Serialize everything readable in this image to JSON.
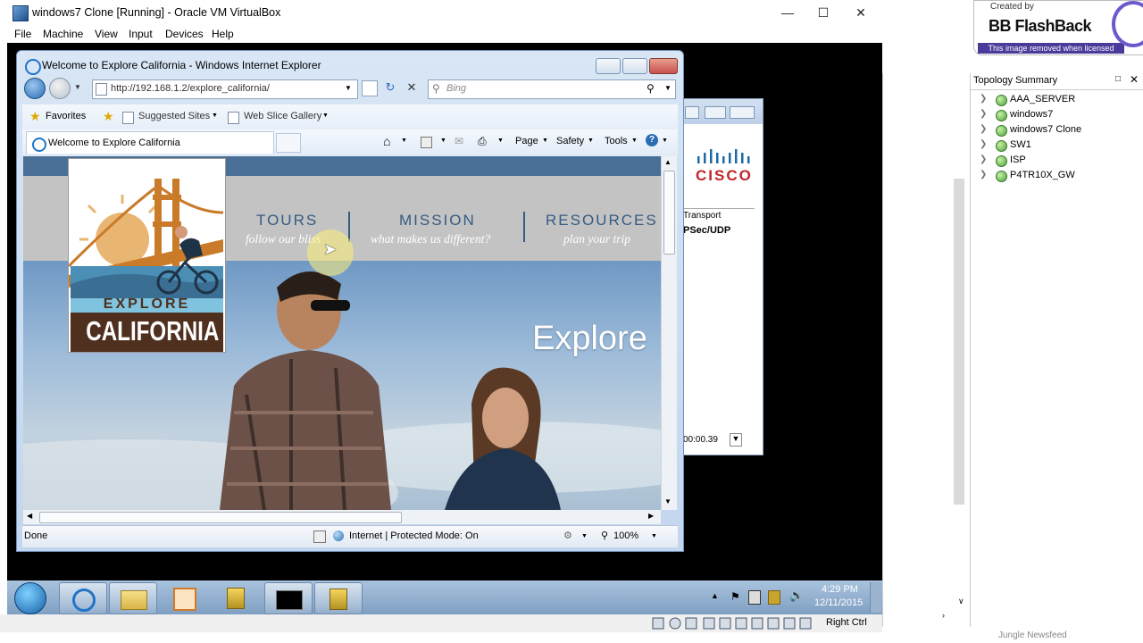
{
  "vbox": {
    "title": "windows7 Clone [Running] - Oracle VM VirtualBox",
    "menu": [
      "File",
      "Machine",
      "View",
      "Input",
      "Devices",
      "Help"
    ],
    "status_hotkey": "Right Ctrl"
  },
  "watermark": {
    "created_by": "Created by",
    "brand": "BB FlashBack",
    "removed_note": "This image removed when licensed"
  },
  "topology": {
    "title": "Topology Summary",
    "items": [
      "AAA_SERVER",
      "windows7",
      "windows7 Clone",
      "SW1",
      "ISP",
      "P4TR10X_GW"
    ]
  },
  "bottom_hint": "Jungle Newsfeed",
  "cisco_window": {
    "logo_text": "CISCO",
    "col_header": "Transport",
    "cell": "PSec/UDP",
    "timer": "00:00.39"
  },
  "ie": {
    "window_title": "Welcome to Explore California - Windows Internet Explorer",
    "url": "http://192.168.1.2/explore_california/",
    "search_placeholder": "Bing",
    "favorites_label": "Favorites",
    "suggested_sites": "Suggested Sites",
    "web_slice_gallery": "Web Slice Gallery",
    "tab_title": "Welcome to Explore California",
    "cmd": {
      "page": "Page",
      "safety": "Safety",
      "tools": "Tools"
    },
    "status_done": "Done",
    "status_zone": "Internet | Protected Mode: On",
    "zoom": "100%"
  },
  "site": {
    "logo_line1": "EXPLORE",
    "logo_line2": "CALIFORNIA",
    "nav": [
      {
        "main": "TOURS",
        "sub": "follow our bliss"
      },
      {
        "main": "MISSION",
        "sub": "what makes us different?"
      },
      {
        "main": "RESOURCES",
        "sub": "plan your trip"
      }
    ],
    "hero_text": "Explore"
  },
  "taskbar": {
    "time": "4:29 PM",
    "date": "12/11/2015"
  }
}
